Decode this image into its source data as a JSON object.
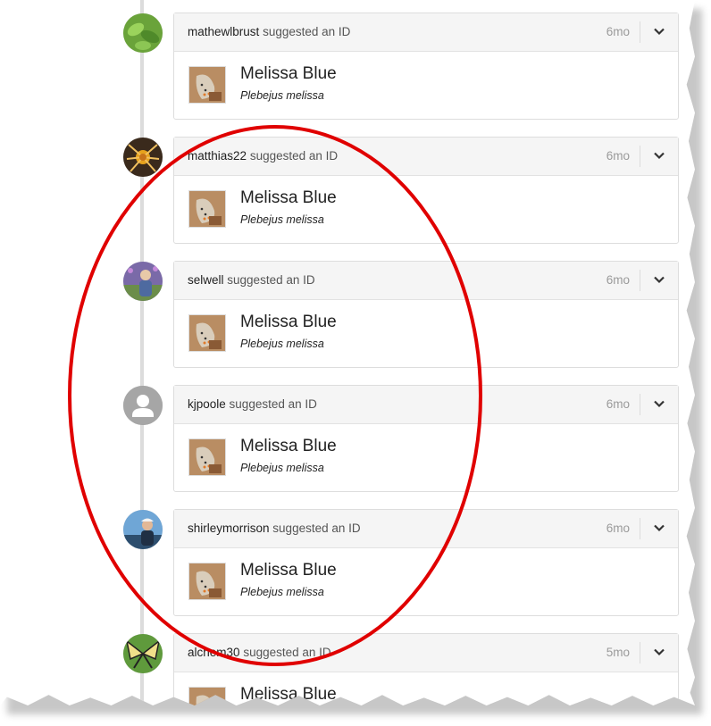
{
  "identifications": [
    {
      "user": "mathewlbrust",
      "action": "suggested an ID",
      "time": "6mo",
      "common_name": "Melissa Blue",
      "scientific_name": "Plebejus melissa",
      "avatar": "plant-photo-avatar"
    },
    {
      "user": "matthias22",
      "action": "suggested an ID",
      "time": "6mo",
      "common_name": "Melissa Blue",
      "scientific_name": "Plebejus melissa",
      "avatar": "spider-photo-avatar"
    },
    {
      "user": "selwell",
      "action": "suggested an ID",
      "time": "6mo",
      "common_name": "Melissa Blue",
      "scientific_name": "Plebejus melissa",
      "avatar": "person-photo-avatar"
    },
    {
      "user": "kjpoole",
      "action": "suggested an ID",
      "time": "6mo",
      "common_name": "Melissa Blue",
      "scientific_name": "Plebejus melissa",
      "avatar": "default-user-avatar"
    },
    {
      "user": "shirleymorrison",
      "action": "suggested an ID",
      "time": "6mo",
      "common_name": "Melissa Blue",
      "scientific_name": "Plebejus melissa",
      "avatar": "person-photo-avatar"
    },
    {
      "user": "alchem30",
      "action": "suggested an ID",
      "time": "5mo",
      "common_name": "Melissa Blue",
      "scientific_name": "",
      "avatar": "swallowtail-photo-avatar"
    }
  ],
  "colors": {
    "annotation_ellipse": "#e00000",
    "timeline": "#dcdcdc",
    "card_header": "#f5f5f5"
  },
  "icons": {
    "menu": "chevron-down-icon",
    "default_avatar": "user-silhouette-icon"
  }
}
